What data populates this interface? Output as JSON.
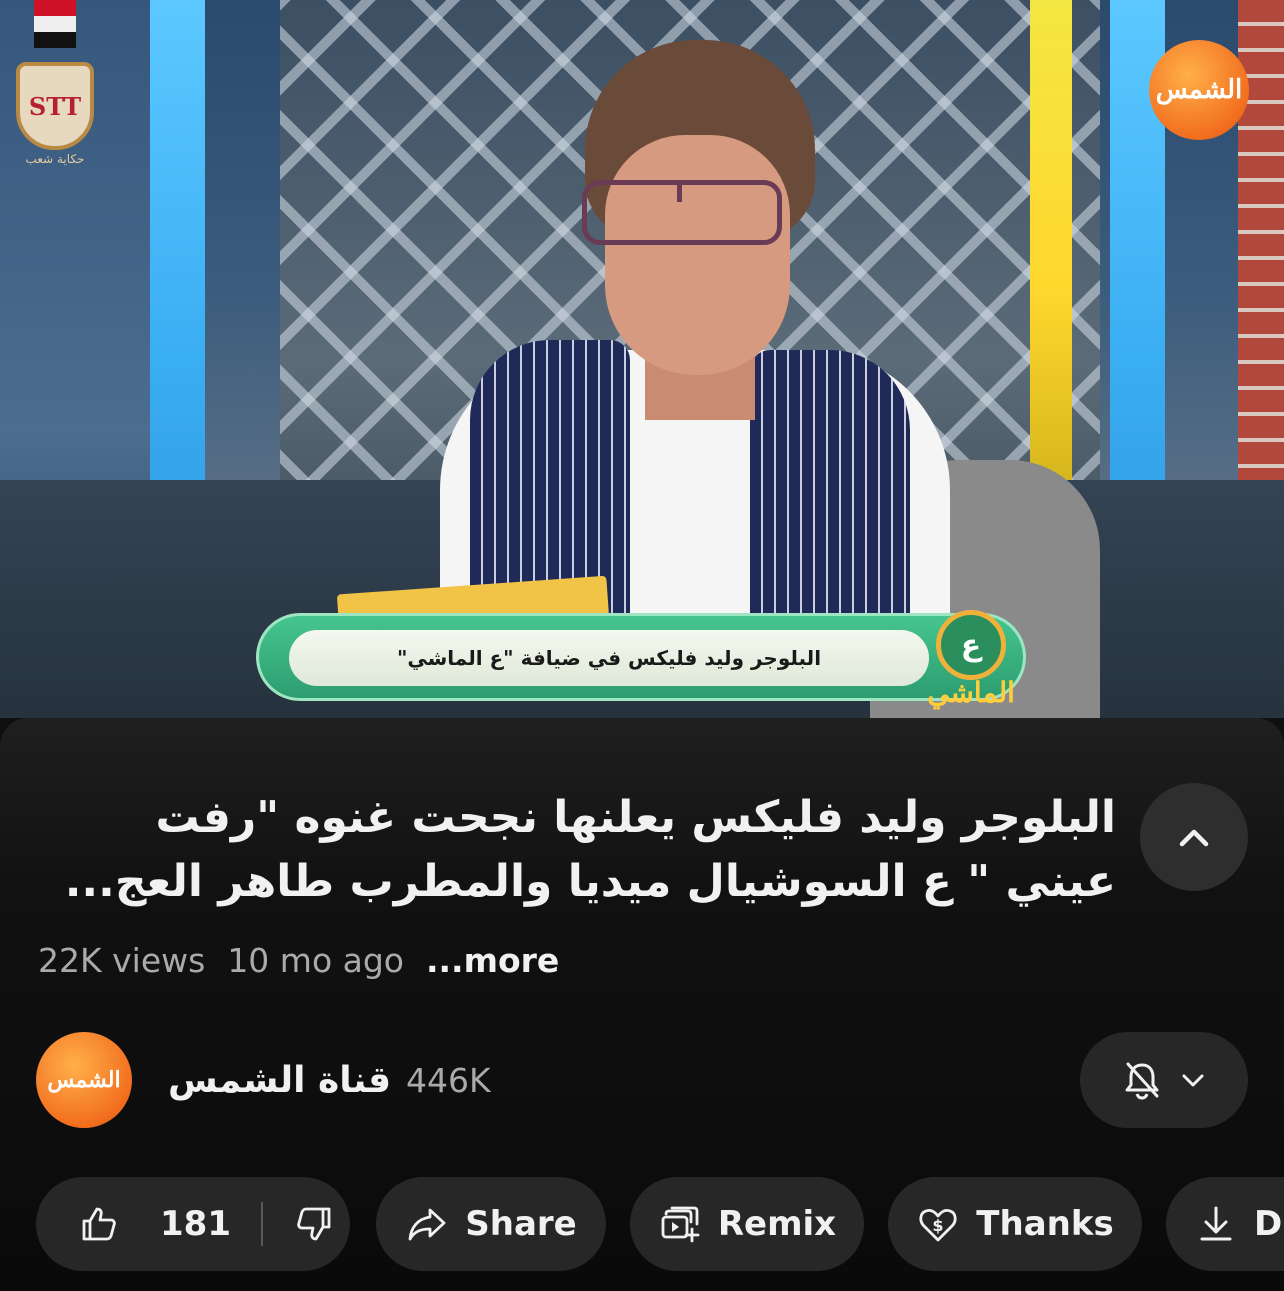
{
  "video": {
    "channel_logo_text": "الشمس",
    "top_left_logo_caption": "حكاية شعب",
    "top_left_logo_mark": "STT",
    "lower_third_text": "البلوجر وليد فليكس في ضيافة \"ع الماشي\"",
    "show_badge_letter": "ع",
    "show_badge_word": "الماشي"
  },
  "info": {
    "title": "البلوجر وليد فليكس يعلنها نجحت غنوه \"رفت عيني \" ع السوشيال ميديا والمطرب طاهر العج...",
    "views": "22K views",
    "age": "10 mo ago",
    "more_label": "...more"
  },
  "channel": {
    "avatar_text": "الشمس",
    "name": "قناة الشمس",
    "subscribers": "446K"
  },
  "actions": {
    "like_count": "181",
    "share_label": "Share",
    "remix_label": "Remix",
    "thanks_label": "Thanks",
    "download_label": "D"
  },
  "icons": {
    "collapse": "chevron-up-icon",
    "bell": "bell-off-icon",
    "bell_menu": "chevron-down-icon",
    "like": "thumbs-up-icon",
    "dislike": "thumbs-down-icon",
    "share": "share-arrow-icon",
    "remix": "remix-icon",
    "thanks": "heart-dollar-icon",
    "download": "download-icon"
  }
}
